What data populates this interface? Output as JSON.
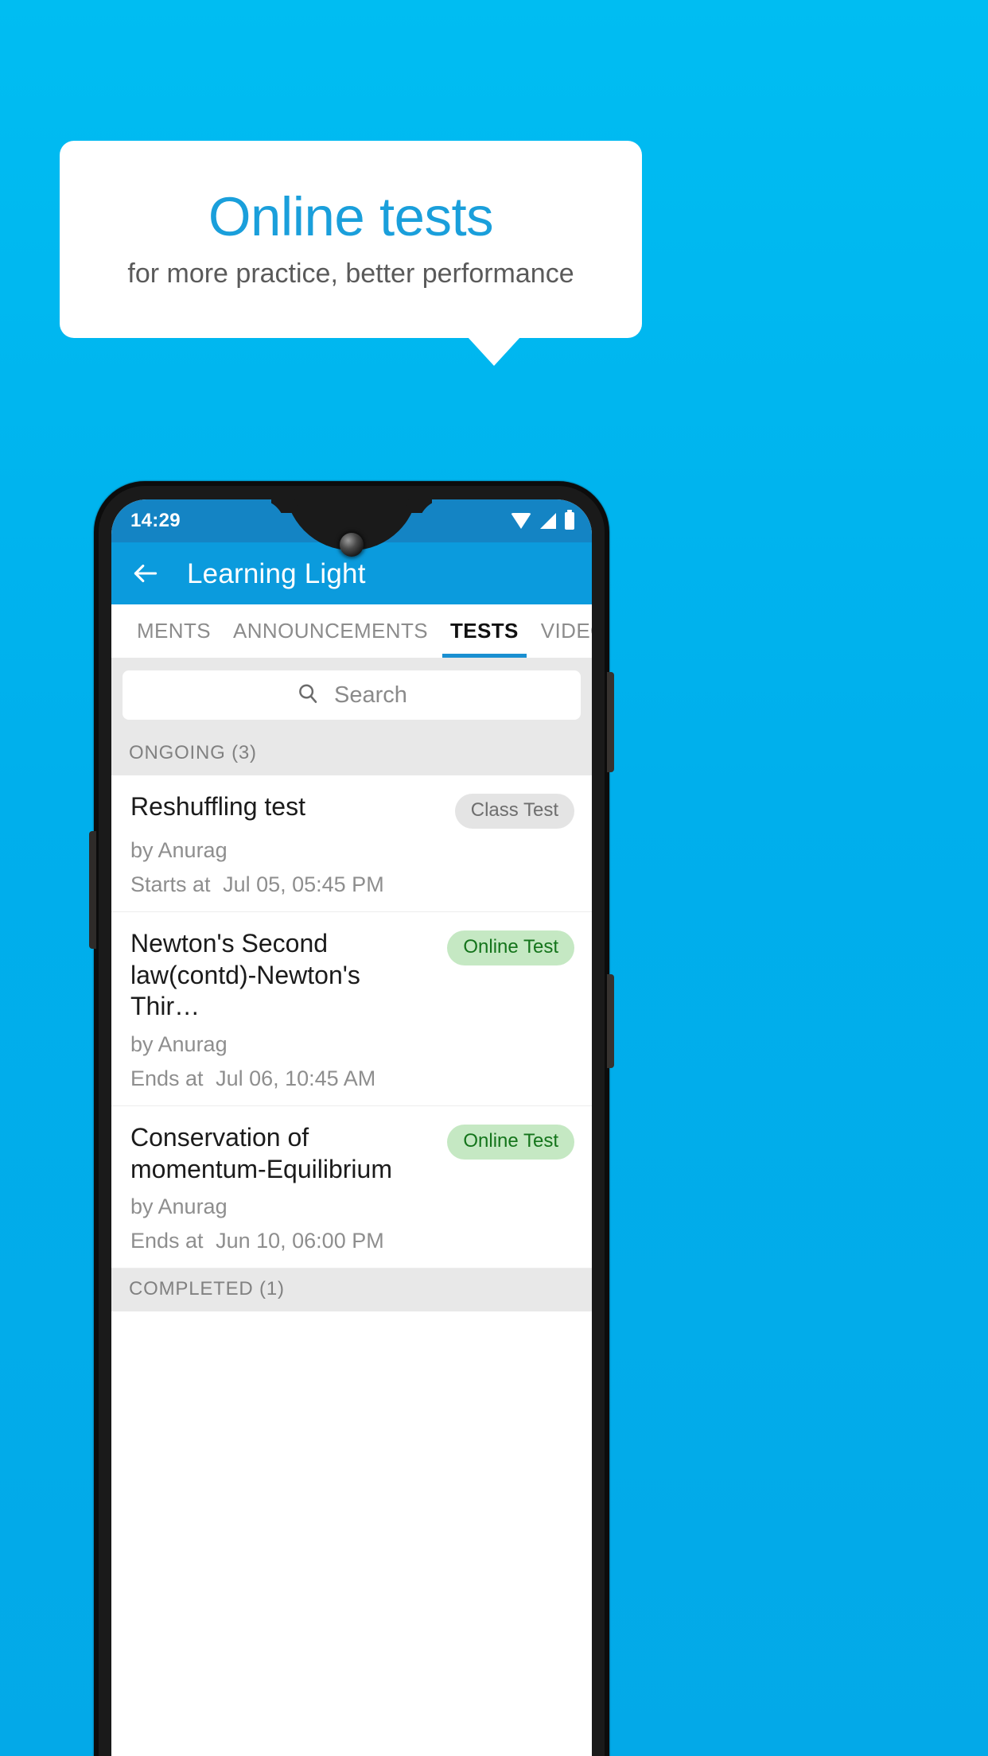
{
  "promo": {
    "title": "Online tests",
    "subtitle": "for more practice, better performance",
    "title_color": "#1A9FDB",
    "subtitle_color": "#5A5A5A",
    "background_color": "#00AFEC"
  },
  "phone": {
    "status_bar": {
      "time": "14:29",
      "icons": [
        "wifi-icon",
        "signal-icon",
        "battery-icon"
      ],
      "background_color": "#1484C4"
    },
    "app_bar": {
      "back_icon": "back-arrow-icon",
      "title": "Learning Light",
      "background_color": "#0B9BDD"
    },
    "tabs": [
      {
        "label": "MENTS",
        "active": false
      },
      {
        "label": "ANNOUNCEMENTS",
        "active": false
      },
      {
        "label": "TESTS",
        "active": true
      },
      {
        "label": "VIDEOS",
        "active": false
      }
    ],
    "tab_indicator_color": "#1A8FD1",
    "search": {
      "icon": "search-icon",
      "placeholder": "Search",
      "value": ""
    },
    "sections": [
      {
        "header": "ONGOING (3)",
        "items": [
          {
            "title": "Reshuffling test",
            "author": "by Anurag",
            "time_label": "Starts at",
            "time_value": "Jul 05, 05:45 PM",
            "badge": "Class Test",
            "badge_type": "class",
            "badge_bg": "#E4E4E4",
            "badge_fg": "#6E6E6E"
          },
          {
            "title": "Newton's Second law(contd)-Newton's Thir…",
            "author": "by Anurag",
            "time_label": "Ends at",
            "time_value": "Jul 06, 10:45 AM",
            "badge": "Online Test",
            "badge_type": "online",
            "badge_bg": "#C5E8C3",
            "badge_fg": "#14741B"
          },
          {
            "title": "Conservation of momentum-Equilibrium",
            "author": "by Anurag",
            "time_label": "Ends at",
            "time_value": "Jun 10, 06:00 PM",
            "badge": "Online Test",
            "badge_type": "online",
            "badge_bg": "#C5E8C3",
            "badge_fg": "#14741B"
          }
        ]
      },
      {
        "header": "COMPLETED (1)",
        "items": []
      }
    ]
  }
}
